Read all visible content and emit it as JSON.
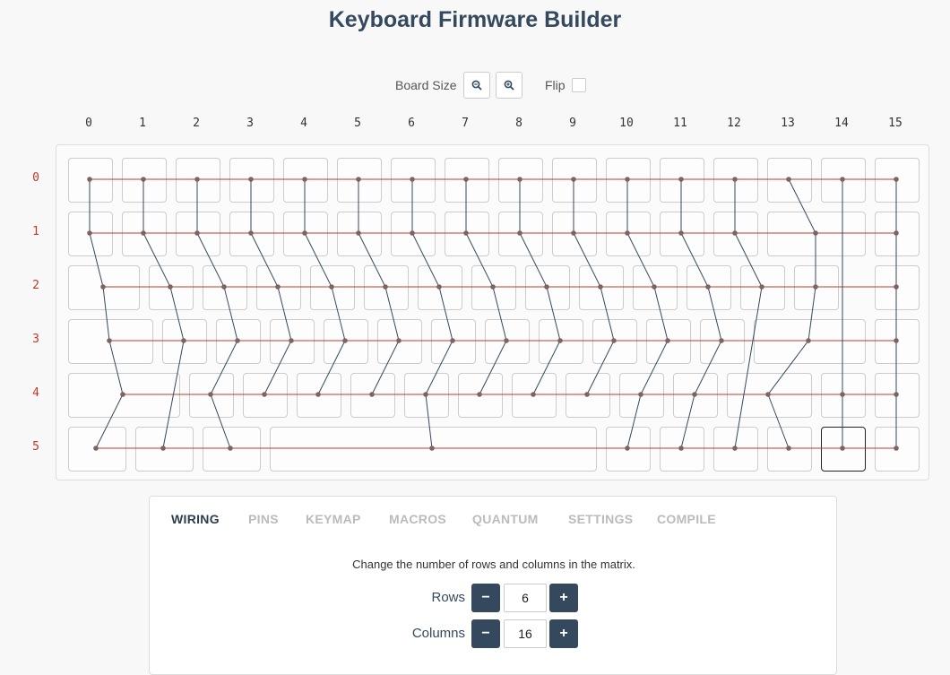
{
  "title": "Keyboard Firmware Builder",
  "controls": {
    "board_size_label": "Board Size",
    "zoom_out_icon": "zoom-out-icon",
    "zoom_in_icon": "zoom-in-icon",
    "flip_label": "Flip",
    "flip_checked": false
  },
  "matrix": {
    "column_labels": [
      "0",
      "1",
      "2",
      "3",
      "4",
      "5",
      "6",
      "7",
      "8",
      "9",
      "10",
      "11",
      "12",
      "13",
      "14",
      "15"
    ],
    "row_labels": [
      "0",
      "1",
      "2",
      "3",
      "4",
      "5"
    ]
  },
  "colors": {
    "row_wire": "#b5402e",
    "col_wire": "#34495e",
    "node": "#7f6363",
    "button": "#34495e"
  },
  "tabs": [
    {
      "label": "WIRING",
      "active": true
    },
    {
      "label": "PINS",
      "active": false
    },
    {
      "label": "KEYMAP",
      "active": false
    },
    {
      "label": "MACROS",
      "active": false
    },
    {
      "label": "QUANTUM",
      "active": false
    },
    {
      "label": "SETTINGS",
      "active": false
    },
    {
      "label": "COMPILE",
      "active": false
    }
  ],
  "wiring": {
    "help_text": "Change the number of rows and columns in the matrix.",
    "rows_label": "Rows",
    "rows_value": "6",
    "columns_label": "Columns",
    "columns_value": "16",
    "minus_symbol": "−",
    "plus_symbol": "+"
  }
}
